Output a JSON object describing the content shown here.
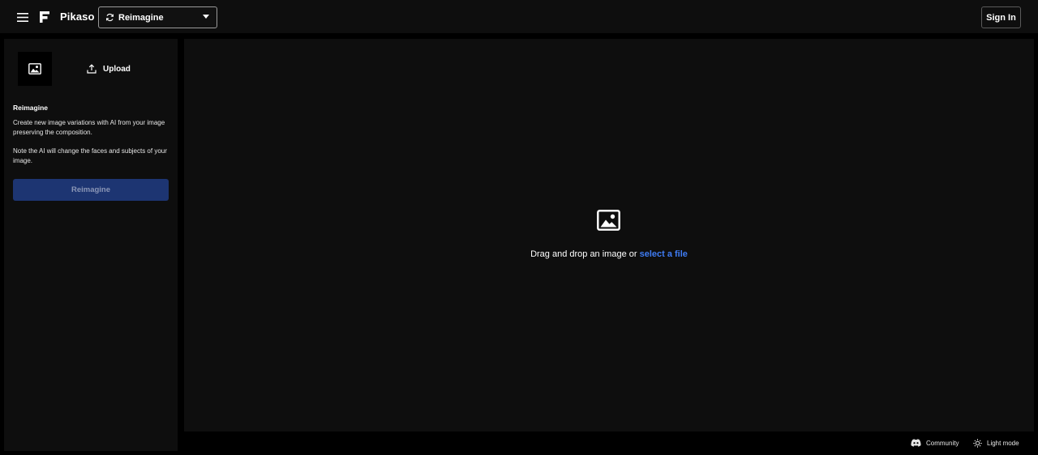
{
  "header": {
    "brand": "Pikaso",
    "tool_select": {
      "selected": "Reimagine"
    },
    "sign_in_label": "Sign In"
  },
  "sidebar": {
    "upload_label": "Upload",
    "section_title": "Reimagine",
    "description": "Create new image variations with AI from your image preserving the composition.",
    "note": "Note the AI will change the faces and subjects of your image.",
    "action_label": "Reimagine"
  },
  "canvas": {
    "drop_text": "Drag and drop an image or ",
    "drop_link": "select a file"
  },
  "footer": {
    "community_label": "Community",
    "light_mode_label": "Light mode"
  },
  "colors": {
    "background": "#000000",
    "panel": "#0e0e0e",
    "accent_link": "#3f7cf4",
    "primary_button": "#1d3572"
  },
  "icons": [
    "menu-icon",
    "logo-icon",
    "refresh-icon",
    "caret-down-icon",
    "image-icon",
    "upload-icon",
    "discord-icon",
    "sun-icon"
  ]
}
